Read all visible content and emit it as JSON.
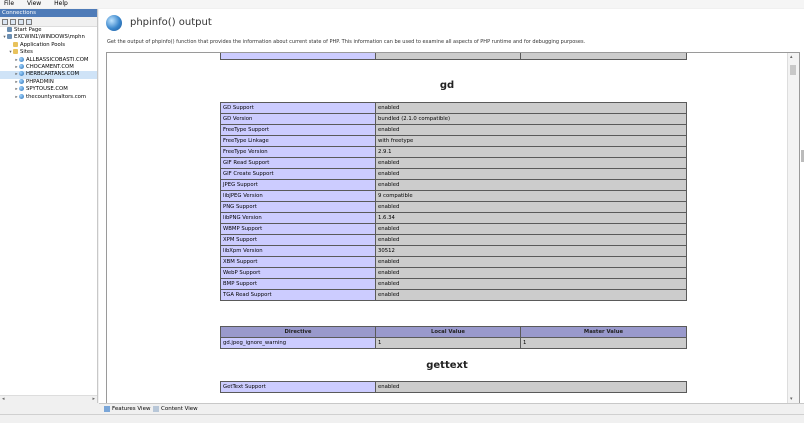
{
  "menu": [
    "File",
    "View",
    "Help"
  ],
  "connections": {
    "title": "Connections",
    "tree": [
      {
        "label": "Start Page",
        "icon": "server-icon",
        "level": 0,
        "exp": ""
      },
      {
        "label": "EXCWIN1\\WINDOWS\\mphn",
        "icon": "server-icon",
        "level": 0,
        "exp": "▾"
      },
      {
        "label": "Application Pools",
        "icon": "folder-icon",
        "level": 1,
        "exp": ""
      },
      {
        "label": "Sites",
        "icon": "folder-icon",
        "level": 1,
        "exp": "▾"
      },
      {
        "label": "ALLBASSICOBASTI.COM",
        "icon": "globe-icon",
        "level": 2,
        "exp": "▸"
      },
      {
        "label": "CHOCAMENT.COM",
        "icon": "globe-icon",
        "level": 2,
        "exp": "▸"
      },
      {
        "label": "HERBCARTANS.COM",
        "icon": "globe-icon",
        "level": 2,
        "exp": "▸",
        "selected": true
      },
      {
        "label": "PHPADMIN",
        "icon": "globe-icon",
        "level": 2,
        "exp": "▸"
      },
      {
        "label": "SPYTOUSE.COM",
        "icon": "globe-icon",
        "level": 2,
        "exp": "▸"
      },
      {
        "label": "thecountyrealtors.com",
        "icon": "globe-icon",
        "level": 2,
        "exp": "▸"
      }
    ]
  },
  "page": {
    "title": "phpinfo() output",
    "description": "Get the output of phpinfo() function that provides the information about current state of PHP. This information can be used to examine all aspects of PHP runtime and for debugging purposes."
  },
  "gd": {
    "title": "gd",
    "rows": [
      [
        "GD Support",
        "enabled"
      ],
      [
        "GD Version",
        "bundled (2.1.0 compatible)"
      ],
      [
        "FreeType Support",
        "enabled"
      ],
      [
        "FreeType Linkage",
        "with freetype"
      ],
      [
        "FreeType Version",
        "2.9.1"
      ],
      [
        "GIF Read Support",
        "enabled"
      ],
      [
        "GIF Create Support",
        "enabled"
      ],
      [
        "JPEG Support",
        "enabled"
      ],
      [
        "libJPEG Version",
        "9 compatible"
      ],
      [
        "PNG Support",
        "enabled"
      ],
      [
        "libPNG Version",
        "1.6.34"
      ],
      [
        "WBMP Support",
        "enabled"
      ],
      [
        "XPM Support",
        "enabled"
      ],
      [
        "libXpm Version",
        "30512"
      ],
      [
        "XBM Support",
        "enabled"
      ],
      [
        "WebP Support",
        "enabled"
      ],
      [
        "BMP Support",
        "enabled"
      ],
      [
        "TGA Read Support",
        "enabled"
      ]
    ],
    "directive_header": [
      "Directive",
      "Local Value",
      "Master Value"
    ],
    "directives": [
      [
        "gd.jpeg_ignore_warning",
        "1",
        "1"
      ]
    ]
  },
  "gettext": {
    "title": "gettext",
    "rows": [
      [
        "GetText Support",
        "enabled"
      ]
    ]
  },
  "views": {
    "features": "Features View",
    "content": "Content View"
  }
}
